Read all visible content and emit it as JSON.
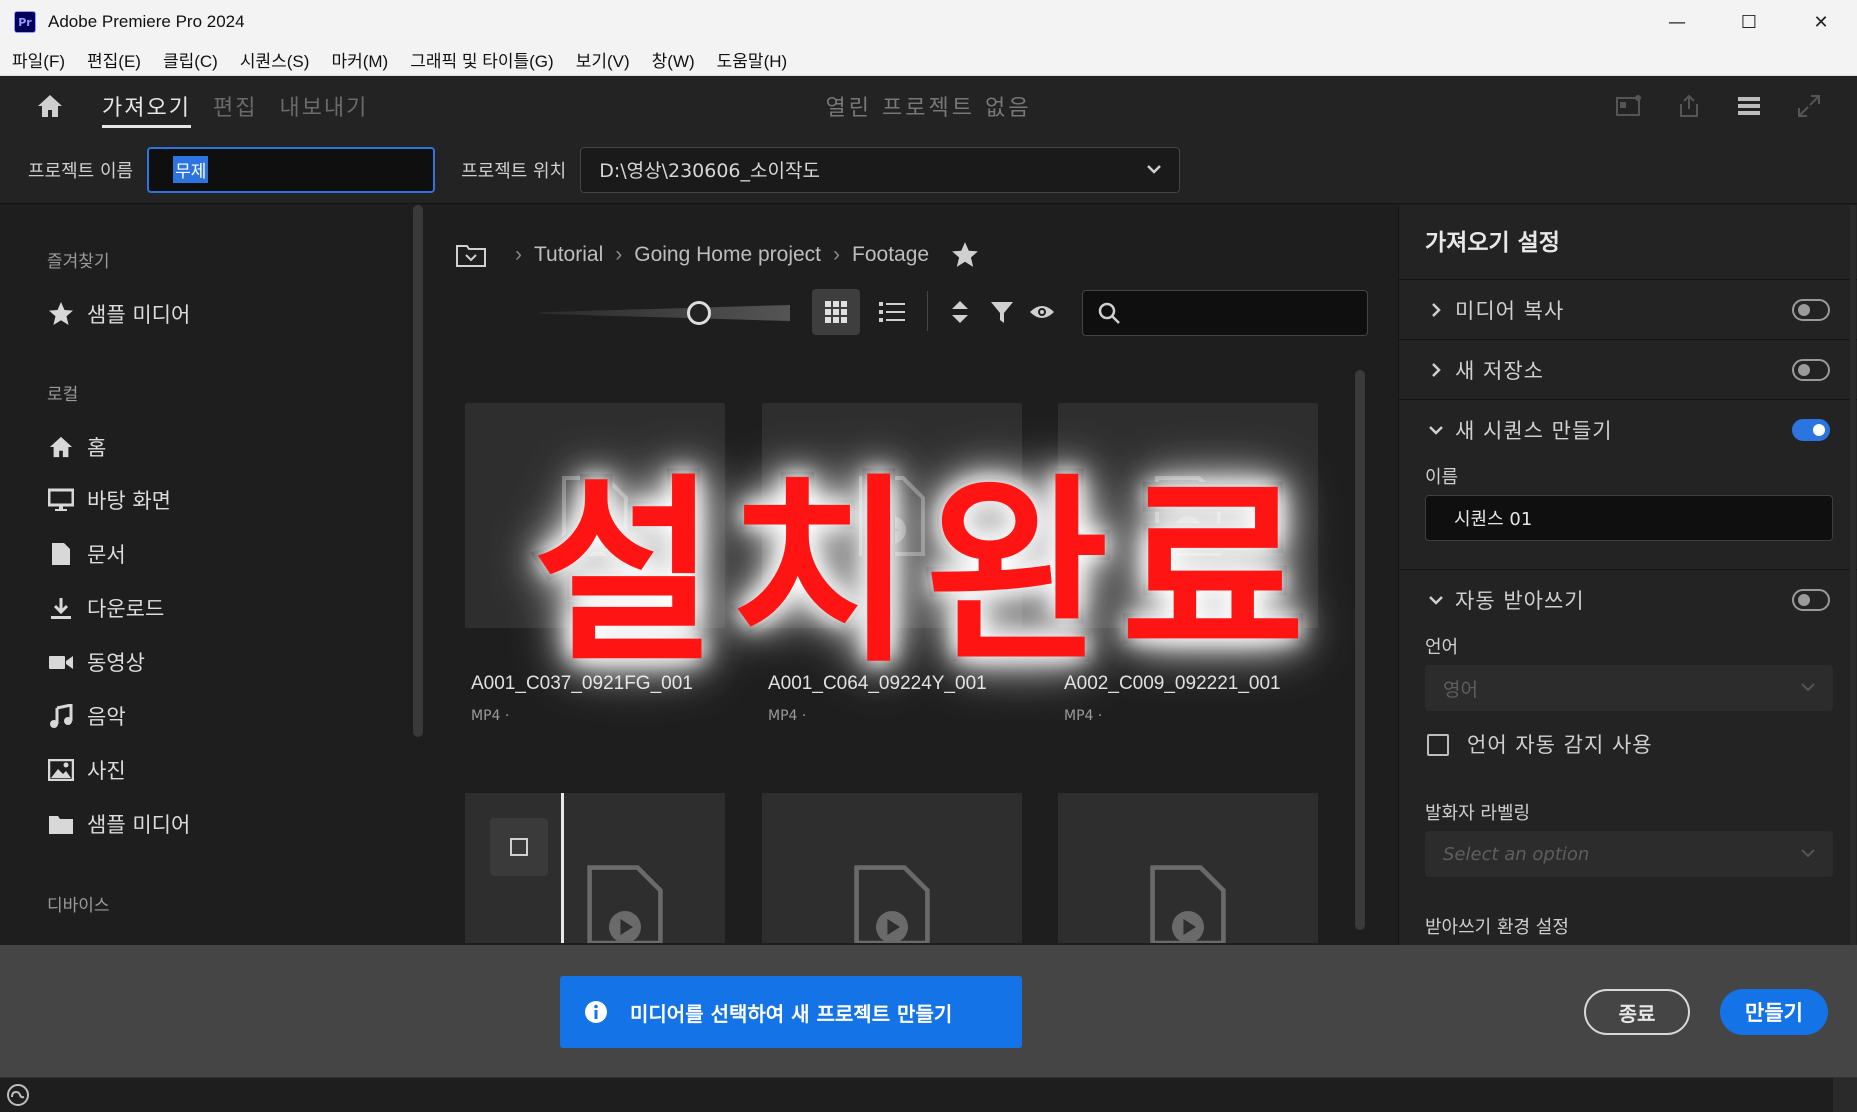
{
  "window": {
    "title": "Adobe Premiere Pro 2024",
    "app_badge": "Pr",
    "minimize": "—",
    "maximize": "☐",
    "close": "✕"
  },
  "menu": [
    "파일(F)",
    "편집(E)",
    "클립(C)",
    "시퀀스(S)",
    "마커(M)",
    "그래픽 및 타이틀(G)",
    "보기(V)",
    "창(W)",
    "도움말(H)"
  ],
  "header": {
    "tabs": [
      {
        "label": "가져오기",
        "active": true
      },
      {
        "label": "편집",
        "active": false
      },
      {
        "label": "내보내기",
        "active": false
      }
    ],
    "center_text": "열린 프로젝트 없음"
  },
  "project": {
    "name_label": "프로젝트 이름",
    "name_value": "무제",
    "location_label": "프로젝트 위치",
    "location_value": "D:\\영상\\230606_소이작도"
  },
  "sidebar": {
    "favorites_heading": "즐겨찾기",
    "favorites": [
      {
        "label": "샘플 미디어",
        "icon": "star-icon"
      }
    ],
    "local_heading": "로컬",
    "local": [
      {
        "label": "홈",
        "icon": "home-icon"
      },
      {
        "label": "바탕 화면",
        "icon": "monitor-icon"
      },
      {
        "label": "문서",
        "icon": "document-icon"
      },
      {
        "label": "다운로드",
        "icon": "download-icon"
      },
      {
        "label": "동영상",
        "icon": "video-camera-icon"
      },
      {
        "label": "음악",
        "icon": "music-note-icon"
      },
      {
        "label": "사진",
        "icon": "image-icon"
      },
      {
        "label": "샘플 미디어",
        "icon": "folder-icon"
      }
    ],
    "devices_heading": "디바이스"
  },
  "browser": {
    "breadcrumb": [
      "Tutorial",
      "Going Home project",
      "Footage"
    ],
    "zoom_level": 0.55,
    "cards": [
      {
        "name": "A001_C037_0921FG_001",
        "meta": "MP4 ·"
      },
      {
        "name": "A001_C064_09224Y_001",
        "meta": "MP4 ·"
      },
      {
        "name": "A002_C009_092221_001",
        "meta": "MP4 ·"
      }
    ]
  },
  "overlay": {
    "text": "설치완료",
    "color": "#ff1414"
  },
  "import_settings": {
    "title": "가져오기 설정",
    "media_copy": {
      "label": "미디어 복사",
      "on": false
    },
    "new_bin": {
      "label": "새 저장소",
      "on": false
    },
    "new_sequence": {
      "label": "새 시퀀스 만들기",
      "on": true
    },
    "name_label": "이름",
    "name_value": "시퀀스 01",
    "auto_transcribe": {
      "label": "자동 받아쓰기",
      "on": false
    },
    "language_label": "언어",
    "language_value": "영어",
    "auto_detect_label": "언어 자동 감지 사용",
    "speaker_label": "발화자 라벨링",
    "speaker_placeholder": "Select an option",
    "transcribe_settings_label": "받아쓰기 환경 설정"
  },
  "footer": {
    "info_text": "미디어를 선택하여 새 프로젝트 만들기",
    "cancel_label": "종료",
    "create_label": "만들기"
  },
  "colors": {
    "accent": "#1473e6",
    "selection": "#2c74e0"
  }
}
